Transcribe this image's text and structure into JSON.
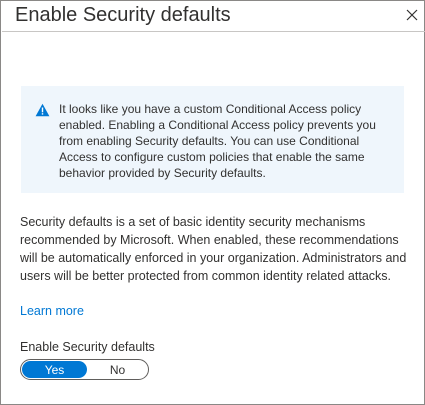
{
  "panel": {
    "title": "Enable Security defaults",
    "close_icon": "close-icon"
  },
  "notice": {
    "icon": "warning-icon",
    "icon_color": "#0078d4",
    "background": "#eff6fc",
    "text": "It looks like you have a custom Conditional Access policy enabled. Enabling a Conditional Access policy prevents you from enabling Security defaults. You can use Conditional Access to configure custom policies that enable the same behavior provided by Security defaults."
  },
  "description": {
    "text": "Security defaults is a set of basic identity security mechanisms recommended by Microsoft. When enabled, these recommendations will be automatically enforced in your organization. Administrators and users will be better protected from common identity related attacks.",
    "learn_more": "Learn more"
  },
  "setting": {
    "label": "Enable Security defaults",
    "options": [
      "Yes",
      "No"
    ],
    "selected": "Yes",
    "accent": "#0078d4"
  }
}
